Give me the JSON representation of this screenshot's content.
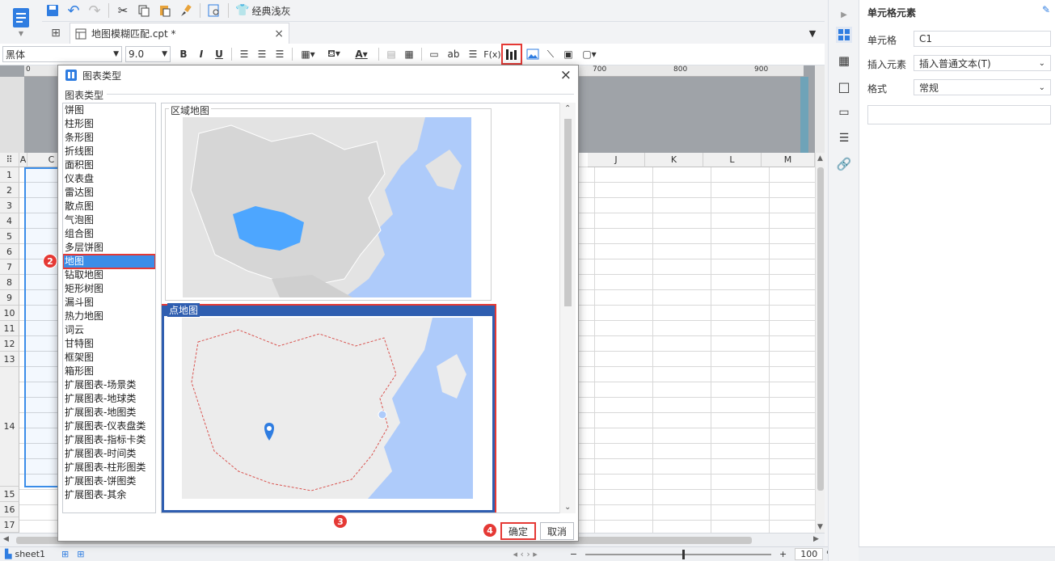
{
  "quick": {
    "theme_label": "经典浅灰"
  },
  "file_tab": {
    "name": "地图模糊匹配.cpt *"
  },
  "format": {
    "font": "黑体",
    "size": "9.0",
    "bold": "B",
    "italic": "I",
    "underline": "U",
    "text_ab": "ab",
    "formula": "F(x)"
  },
  "ruler": {
    "ticks": [
      "0",
      "700",
      "800",
      "900"
    ]
  },
  "columns": [
    "A",
    "C",
    "J",
    "K",
    "L",
    "M"
  ],
  "rows": [
    "1",
    "2",
    "3",
    "4",
    "5",
    "6",
    "7",
    "8",
    "9",
    "10",
    "11",
    "12",
    "13",
    "14",
    "15",
    "16",
    "17"
  ],
  "status": {
    "sheet": "sheet1",
    "zoom": "100",
    "zoom_unit": "%"
  },
  "panel": {
    "title": "单元格元素",
    "cell_label": "单元格",
    "cell_value": "C1",
    "insert_label": "插入元素",
    "insert_value": "插入普通文本(T)",
    "format_label": "格式",
    "format_value": "常规"
  },
  "dialog": {
    "title": "图表类型",
    "group_label": "图表类型",
    "types": [
      "饼图",
      "柱形图",
      "条形图",
      "折线图",
      "面积图",
      "仪表盘",
      "雷达图",
      "散点图",
      "气泡图",
      "组合图",
      "多层饼图",
      "地图",
      "钻取地图",
      "矩形树图",
      "漏斗图",
      "热力地图",
      "词云",
      "甘特图",
      "框架图",
      "箱形图",
      "扩展图表-场景类",
      "扩展图表-地球类",
      "扩展图表-地图类",
      "扩展图表-仪表盘类",
      "扩展图表-指标卡类",
      "扩展图表-时间类",
      "扩展图表-柱形图类",
      "扩展图表-饼图类",
      "扩展图表-其余"
    ],
    "selected_index": 11,
    "preview_1": "区域地图",
    "preview_2": "点地图",
    "ok": "确定",
    "cancel": "取消"
  },
  "badges": [
    "1",
    "2",
    "3",
    "4"
  ],
  "colors": {
    "accent": "#3b8de8",
    "highlight": "#e53935",
    "selected_frame": "#2f5eb0",
    "map_water": "#aecbfa",
    "map_land": "#e3e3e3",
    "map_region": "#4da6ff"
  }
}
